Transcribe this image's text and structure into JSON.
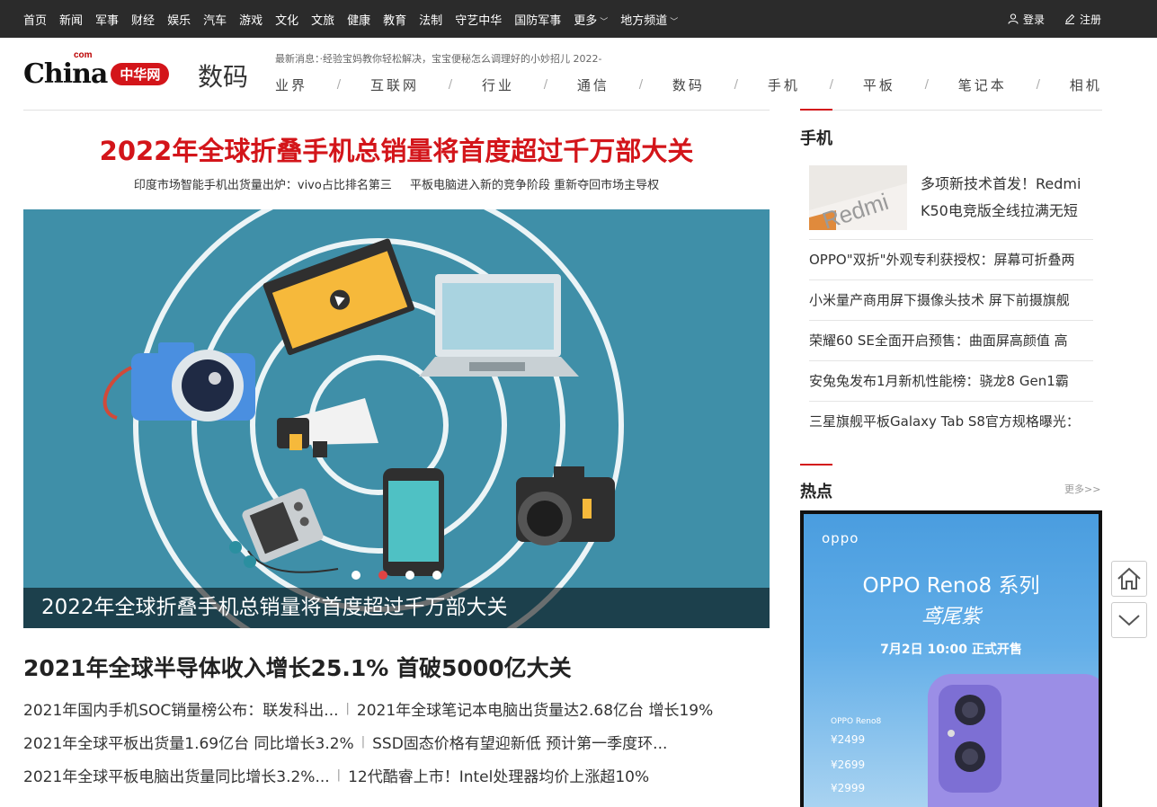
{
  "topnav": {
    "items": [
      "首页",
      "新闻",
      "军事",
      "财经",
      "娱乐",
      "汽车",
      "游戏",
      "文化",
      "文旅",
      "健康",
      "教育",
      "法制",
      "守艺中华",
      "国防军事"
    ],
    "more": "更多",
    "local": "地方频道",
    "login": "登录",
    "register": "注册"
  },
  "header": {
    "logo_china": "China",
    "logo_com": "com",
    "logo_cn": "中华网",
    "channel": "数码",
    "ticker": "最新消息：·经验宝妈教你轻松解决，宝宝便秘怎么调理好的小妙招儿 2022-",
    "categories": [
      "业界",
      "互联网",
      "行业",
      "通信",
      "数码",
      "手机",
      "平板",
      "笔记本",
      "相机"
    ]
  },
  "main": {
    "headline": "2022年全球折叠手机总销量将首度超过千万部大关",
    "subheads": [
      "印度市场智能手机出货量出炉：vivo占比排名第三",
      "平板电脑进入新的竞争阶段 重新夺回市场主导权"
    ],
    "slider_caption": "2022年全球折叠手机总销量将首度超过千万部大关",
    "slide_count": 4,
    "active_slide": 2,
    "story_title": "2021年全球半导体收入增长25.1% 首破5000亿大关",
    "story_rows": [
      [
        "2021年国内手机SOC销量榜公布：联发科出...",
        "2021年全球笔记本电脑出货量达2.68亿台 增长19%"
      ],
      [
        "2021年全球平板出货量1.69亿台 同比增长3.2%",
        "SSD固态价格有望迎新低 预计第一季度环..."
      ],
      [
        "2021年全球平板电脑出货量同比增长3.2%...",
        "12代酷睿上市！Intel处理器均价上涨超10%"
      ]
    ]
  },
  "sidebar": {
    "phone_title": "手机",
    "feature_image_text": "Redmi",
    "feature_text": "多项新技术首发！Redmi K50电竞版全线拉满无短",
    "news": [
      "OPPO\"双折\"外观专利获授权：屏幕可折叠两",
      "小米量产商用屏下摄像头技术 屏下前摄旗舰",
      "荣耀60 SE全面开启预售：曲面屏高颜值 高",
      "安兔兔发布1月新机性能榜：骁龙8 Gen1霸",
      "三星旗舰平板Galaxy Tab S8官方规格曝光："
    ],
    "hot_title": "热点",
    "more": "更多>>",
    "ad": {
      "brand": "oppo",
      "title": "OPPO Reno8 系列",
      "script": "鸢尾紫",
      "date": "7月2日 10:00 正式开售",
      "model": "OPPO Reno8",
      "prices": [
        "¥2499",
        "¥2699",
        "¥2999"
      ]
    }
  },
  "colors": {
    "accent": "#d3151a",
    "topbar": "#2b2b2b",
    "slider_bg": "#3f8fa8"
  }
}
